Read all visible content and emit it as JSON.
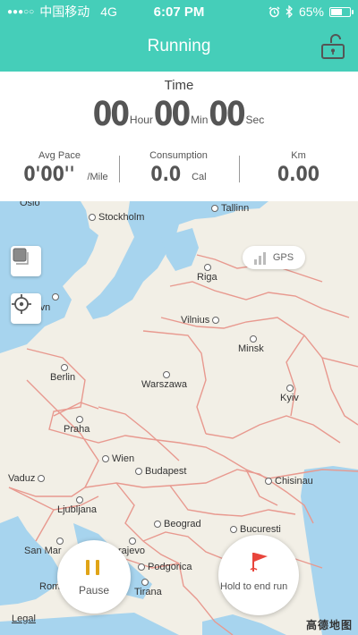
{
  "status_bar": {
    "signal_dots": "●●●○○",
    "carrier": "中国移动",
    "network": "4G",
    "time": "6:07 PM",
    "battery_percent": "65%",
    "battery_level": 0.65
  },
  "nav": {
    "title": "Running",
    "lock_icon": "unlock-icon"
  },
  "stats": {
    "time_label": "Time",
    "hours": "00",
    "hour_unit": "Hour",
    "minutes": "00",
    "min_unit": "Min",
    "seconds": "00",
    "sec_unit": "Sec",
    "avg_pace_label": "Avg Pace",
    "avg_pace_value": "0'00''",
    "avg_pace_unit": "/Mile",
    "consumption_label": "Consumption",
    "consumption_value": "0.0",
    "consumption_unit": "Cal",
    "km_label": "Km",
    "km_value": "0.00"
  },
  "map": {
    "gps_label": "GPS",
    "cities": [
      {
        "name": "Oslo",
        "pin": false
      },
      {
        "name": "Stockholm",
        "pin": true
      },
      {
        "name": "Tallinn",
        "pin": true
      },
      {
        "name": "Riga",
        "pin": true
      },
      {
        "name": "penhavn",
        "pin": true
      },
      {
        "name": "Vilnius",
        "pin": true
      },
      {
        "name": "Minsk",
        "pin": true
      },
      {
        "name": "Berlin",
        "pin": true
      },
      {
        "name": "Warszawa",
        "pin": true
      },
      {
        "name": "Kyiv",
        "pin": true
      },
      {
        "name": "Praha",
        "pin": true
      },
      {
        "name": "Wien",
        "pin": true
      },
      {
        "name": "Budapest",
        "pin": true
      },
      {
        "name": "Vaduz",
        "pin": true
      },
      {
        "name": "Chisinau",
        "pin": true
      },
      {
        "name": "Ljubljana",
        "pin": true
      },
      {
        "name": "Beograd",
        "pin": true
      },
      {
        "name": "Bucuresti",
        "pin": true
      },
      {
        "name": "San Mar",
        "pin": true
      },
      {
        "name": "rajevo",
        "pin": true
      },
      {
        "name": "Podgorica",
        "pin": true
      },
      {
        "name": "Rom",
        "pin": true
      },
      {
        "name": "Tirana",
        "pin": true
      }
    ],
    "legal": "Legal",
    "provider": "高德地图"
  },
  "controls": {
    "pause_label": "Pause",
    "end_label": "Hold to end run"
  },
  "colors": {
    "brand": "#45ceb9",
    "pause_accent": "#e0a417",
    "flag_red": "#e8453c",
    "border_red": "#e8998f",
    "water": "#a7d4ee"
  }
}
